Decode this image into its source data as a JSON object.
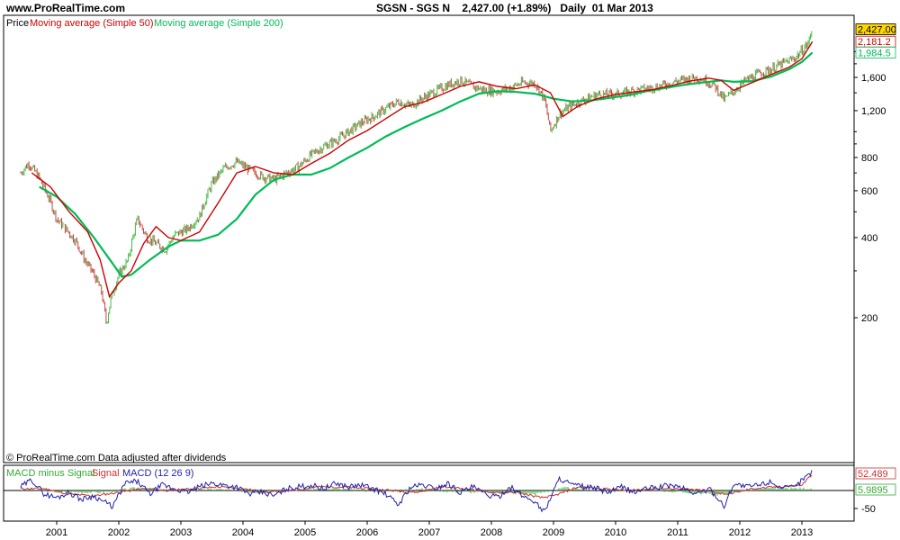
{
  "header": {
    "site": "www.ProRealTime.com",
    "title": "SGSN - SGS N    2,427.00 (+1.89%)   Daily  01 Mar 2013"
  },
  "legend": {
    "price": "Price",
    "ma50": "Moving average (Simple 50)",
    "ma200": "Moving average (Simple 200)"
  },
  "footnote": "© ProRealTime.com  Data adjusted after dividends",
  "macd_legend": {
    "hist": "MACD minus Signal",
    "signal": "Signal",
    "macd": "MACD (12 26 9)"
  },
  "colors": {
    "price_up": "#44bb44",
    "price_down": "#cc4444",
    "ma50": "#cc0000",
    "ma200": "#00bb55",
    "macd": "#2222aa",
    "signal": "#cc3333",
    "hist": "#33aa33",
    "last_price_bg": "#ffd700"
  },
  "chart_data": [
    {
      "type": "line",
      "scale": "log",
      "ylim": [
        100,
        2500
      ],
      "xlim": [
        2000.4,
        2013.2
      ],
      "ytick_labels": [
        "1,600",
        "1,200",
        "800",
        "600",
        "400",
        "200"
      ],
      "ytick_values": [
        1600,
        1200,
        800,
        600,
        400,
        200
      ],
      "xtick_labels": [
        "2001",
        "2002",
        "2003",
        "2004",
        "2005",
        "2006",
        "2007",
        "2008",
        "2009",
        "2010",
        "2011",
        "2012",
        "2013"
      ],
      "xtick_values": [
        2001,
        2002,
        2003,
        2004,
        2005,
        2006,
        2007,
        2008,
        2009,
        2010,
        2011,
        2012,
        2013
      ],
      "last_values": [
        {
          "label": "2,427.00",
          "series": "price"
        },
        {
          "label": "2,181.2",
          "series": "ma50"
        },
        {
          "label": "1,984.5",
          "series": "ma200"
        }
      ],
      "series": [
        {
          "name": "Price",
          "key": "price",
          "x": [
            2000.42,
            2000.55,
            2000.7,
            2000.85,
            2001.0,
            2001.15,
            2001.3,
            2001.45,
            2001.6,
            2001.72,
            2001.8,
            2001.88,
            2002.0,
            2002.15,
            2002.3,
            2002.45,
            2002.6,
            2002.75,
            2002.9,
            2003.1,
            2003.3,
            2003.5,
            2003.7,
            2003.9,
            2004.1,
            2004.3,
            2004.5,
            2004.7,
            2004.9,
            2005.1,
            2005.3,
            2005.5,
            2005.7,
            2005.9,
            2006.1,
            2006.3,
            2006.5,
            2006.7,
            2006.9,
            2007.1,
            2007.3,
            2007.5,
            2007.7,
            2007.9,
            2008.1,
            2008.3,
            2008.5,
            2008.7,
            2008.85,
            2008.95,
            2009.1,
            2009.3,
            2009.5,
            2009.7,
            2009.9,
            2010.1,
            2010.3,
            2010.5,
            2010.7,
            2010.9,
            2011.1,
            2011.3,
            2011.45,
            2011.6,
            2011.75,
            2011.9,
            2012.1,
            2012.3,
            2012.5,
            2012.7,
            2012.9,
            2013.1,
            2013.17
          ],
          "y": [
            700,
            760,
            680,
            580,
            470,
            430,
            390,
            330,
            290,
            250,
            190,
            240,
            290,
            330,
            470,
            400,
            380,
            360,
            410,
            430,
            480,
            640,
            730,
            770,
            720,
            680,
            660,
            700,
            740,
            820,
            880,
            930,
            1000,
            1080,
            1140,
            1220,
            1300,
            1250,
            1340,
            1420,
            1500,
            1560,
            1480,
            1430,
            1420,
            1460,
            1530,
            1520,
            1330,
            1000,
            1170,
            1260,
            1320,
            1380,
            1380,
            1390,
            1430,
            1450,
            1480,
            1530,
            1570,
            1600,
            1560,
            1480,
            1320,
            1420,
            1560,
            1650,
            1720,
            1810,
            1900,
            2150,
            2427
          ]
        },
        {
          "name": "Moving average (Simple 50)",
          "key": "ma50",
          "x": [
            2000.6,
            2000.9,
            2001.2,
            2001.5,
            2001.7,
            2001.85,
            2002.0,
            2002.2,
            2002.4,
            2002.6,
            2002.8,
            2003.0,
            2003.3,
            2003.6,
            2003.9,
            2004.2,
            2004.5,
            2004.8,
            2005.1,
            2005.4,
            2005.7,
            2006.0,
            2006.3,
            2006.6,
            2006.9,
            2007.2,
            2007.5,
            2007.8,
            2008.1,
            2008.4,
            2008.7,
            2008.95,
            2009.15,
            2009.4,
            2009.7,
            2010.0,
            2010.3,
            2010.6,
            2010.9,
            2011.2,
            2011.5,
            2011.7,
            2011.9,
            2012.2,
            2012.5,
            2012.8,
            2013.0,
            2013.17
          ],
          "y": [
            700,
            620,
            500,
            420,
            330,
            240,
            270,
            300,
            380,
            440,
            400,
            390,
            420,
            540,
            700,
            740,
            700,
            690,
            760,
            830,
            930,
            1010,
            1120,
            1240,
            1290,
            1380,
            1480,
            1540,
            1480,
            1450,
            1500,
            1400,
            1140,
            1250,
            1330,
            1380,
            1410,
            1440,
            1490,
            1550,
            1590,
            1560,
            1430,
            1530,
            1640,
            1750,
            1880,
            2181.2
          ]
        },
        {
          "name": "Moving average (Simple 200)",
          "key": "ma200",
          "x": [
            2000.72,
            2001.0,
            2001.3,
            2001.6,
            2001.9,
            2002.05,
            2002.2,
            2002.5,
            2002.8,
            2003.0,
            2003.3,
            2003.6,
            2003.9,
            2004.2,
            2004.5,
            2004.8,
            2005.1,
            2005.4,
            2005.7,
            2006.0,
            2006.3,
            2006.6,
            2006.9,
            2007.2,
            2007.5,
            2007.8,
            2008.1,
            2008.4,
            2008.7,
            2009.0,
            2009.3,
            2009.6,
            2009.9,
            2010.2,
            2010.5,
            2010.8,
            2011.1,
            2011.4,
            2011.7,
            2011.9,
            2012.2,
            2012.5,
            2012.8,
            2013.0,
            2013.17
          ],
          "y": [
            620,
            570,
            490,
            400,
            320,
            285,
            290,
            330,
            370,
            390,
            390,
            410,
            470,
            580,
            660,
            690,
            690,
            730,
            800,
            870,
            960,
            1040,
            1120,
            1200,
            1300,
            1390,
            1420,
            1410,
            1390,
            1330,
            1300,
            1310,
            1340,
            1370,
            1420,
            1460,
            1500,
            1530,
            1560,
            1540,
            1550,
            1610,
            1720,
            1830,
            1984.5
          ]
        }
      ]
    },
    {
      "type": "line",
      "ylim": [
        -80,
        80
      ],
      "ytick_labels": [
        "-50"
      ],
      "ytick_values": [
        -50
      ],
      "last_values": [
        {
          "label": "52.489",
          "series": "macd"
        },
        {
          "label": "5.9895",
          "series": "hist"
        }
      ],
      "series": [
        {
          "name": "MACD (12 26 9)",
          "key": "macd",
          "x": [
            2000.42,
            2000.6,
            2000.8,
            2001.0,
            2001.2,
            2001.4,
            2001.6,
            2001.75,
            2001.9,
            2002.1,
            2002.3,
            2002.5,
            2002.7,
            2002.9,
            2003.1,
            2003.3,
            2003.5,
            2003.7,
            2003.9,
            2004.1,
            2004.3,
            2004.5,
            2004.7,
            2004.9,
            2005.1,
            2005.3,
            2005.5,
            2005.7,
            2005.9,
            2006.1,
            2006.3,
            2006.5,
            2006.7,
            2006.9,
            2007.1,
            2007.3,
            2007.5,
            2007.7,
            2007.9,
            2008.1,
            2008.3,
            2008.5,
            2008.7,
            2008.85,
            2008.95,
            2009.1,
            2009.3,
            2009.5,
            2009.7,
            2009.9,
            2010.1,
            2010.3,
            2010.5,
            2010.7,
            2010.9,
            2011.1,
            2011.3,
            2011.5,
            2011.62,
            2011.75,
            2011.9,
            2012.1,
            2012.3,
            2012.5,
            2012.7,
            2012.9,
            2013.0,
            2013.17
          ],
          "y": [
            10,
            30,
            -10,
            -20,
            -5,
            -25,
            -15,
            -30,
            -45,
            20,
            25,
            -10,
            15,
            5,
            -5,
            10,
            20,
            15,
            10,
            -10,
            -5,
            -15,
            5,
            10,
            15,
            5,
            20,
            10,
            15,
            5,
            -10,
            -40,
            10,
            15,
            5,
            20,
            -5,
            10,
            -10,
            -20,
            10,
            -15,
            -30,
            -60,
            -20,
            35,
            15,
            10,
            5,
            -5,
            10,
            -5,
            5,
            10,
            15,
            5,
            -10,
            5,
            -15,
            -45,
            20,
            10,
            15,
            25,
            5,
            10,
            30,
            52.489
          ]
        },
        {
          "name": "Signal",
          "key": "signal",
          "x": [
            2000.42,
            2000.8,
            2001.2,
            2001.6,
            2002.0,
            2002.4,
            2002.8,
            2003.2,
            2003.6,
            2004.0,
            2004.4,
            2004.8,
            2005.2,
            2005.6,
            2006.0,
            2006.4,
            2006.8,
            2007.2,
            2007.6,
            2008.0,
            2008.4,
            2008.8,
            2009.0,
            2009.4,
            2009.8,
            2010.2,
            2010.6,
            2011.0,
            2011.4,
            2011.8,
            2012.2,
            2012.6,
            2013.0,
            2013.17
          ],
          "y": [
            5,
            5,
            -10,
            -15,
            -5,
            5,
            0,
            5,
            10,
            5,
            -5,
            0,
            10,
            10,
            5,
            0,
            -5,
            10,
            5,
            -5,
            -5,
            -20,
            -15,
            10,
            5,
            0,
            5,
            5,
            0,
            -10,
            5,
            10,
            15,
            46.5
          ]
        },
        {
          "name": "MACD minus Signal",
          "key": "hist",
          "x": [
            2000.42,
            2001.0,
            2001.7,
            2002.3,
            2003.0,
            2003.6,
            2004.2,
            2004.8,
            2005.5,
            2006.2,
            2006.8,
            2007.4,
            2008.0,
            2008.7,
            2009.2,
            2009.8,
            2010.4,
            2011.0,
            2011.7,
            2012.3,
            2012.9,
            2013.17
          ],
          "y": [
            3,
            -4,
            -6,
            8,
            -2,
            4,
            -5,
            3,
            4,
            -3,
            5,
            -4,
            -6,
            -10,
            8,
            -2,
            3,
            -4,
            -12,
            5,
            6,
            5.9895
          ]
        }
      ]
    }
  ]
}
